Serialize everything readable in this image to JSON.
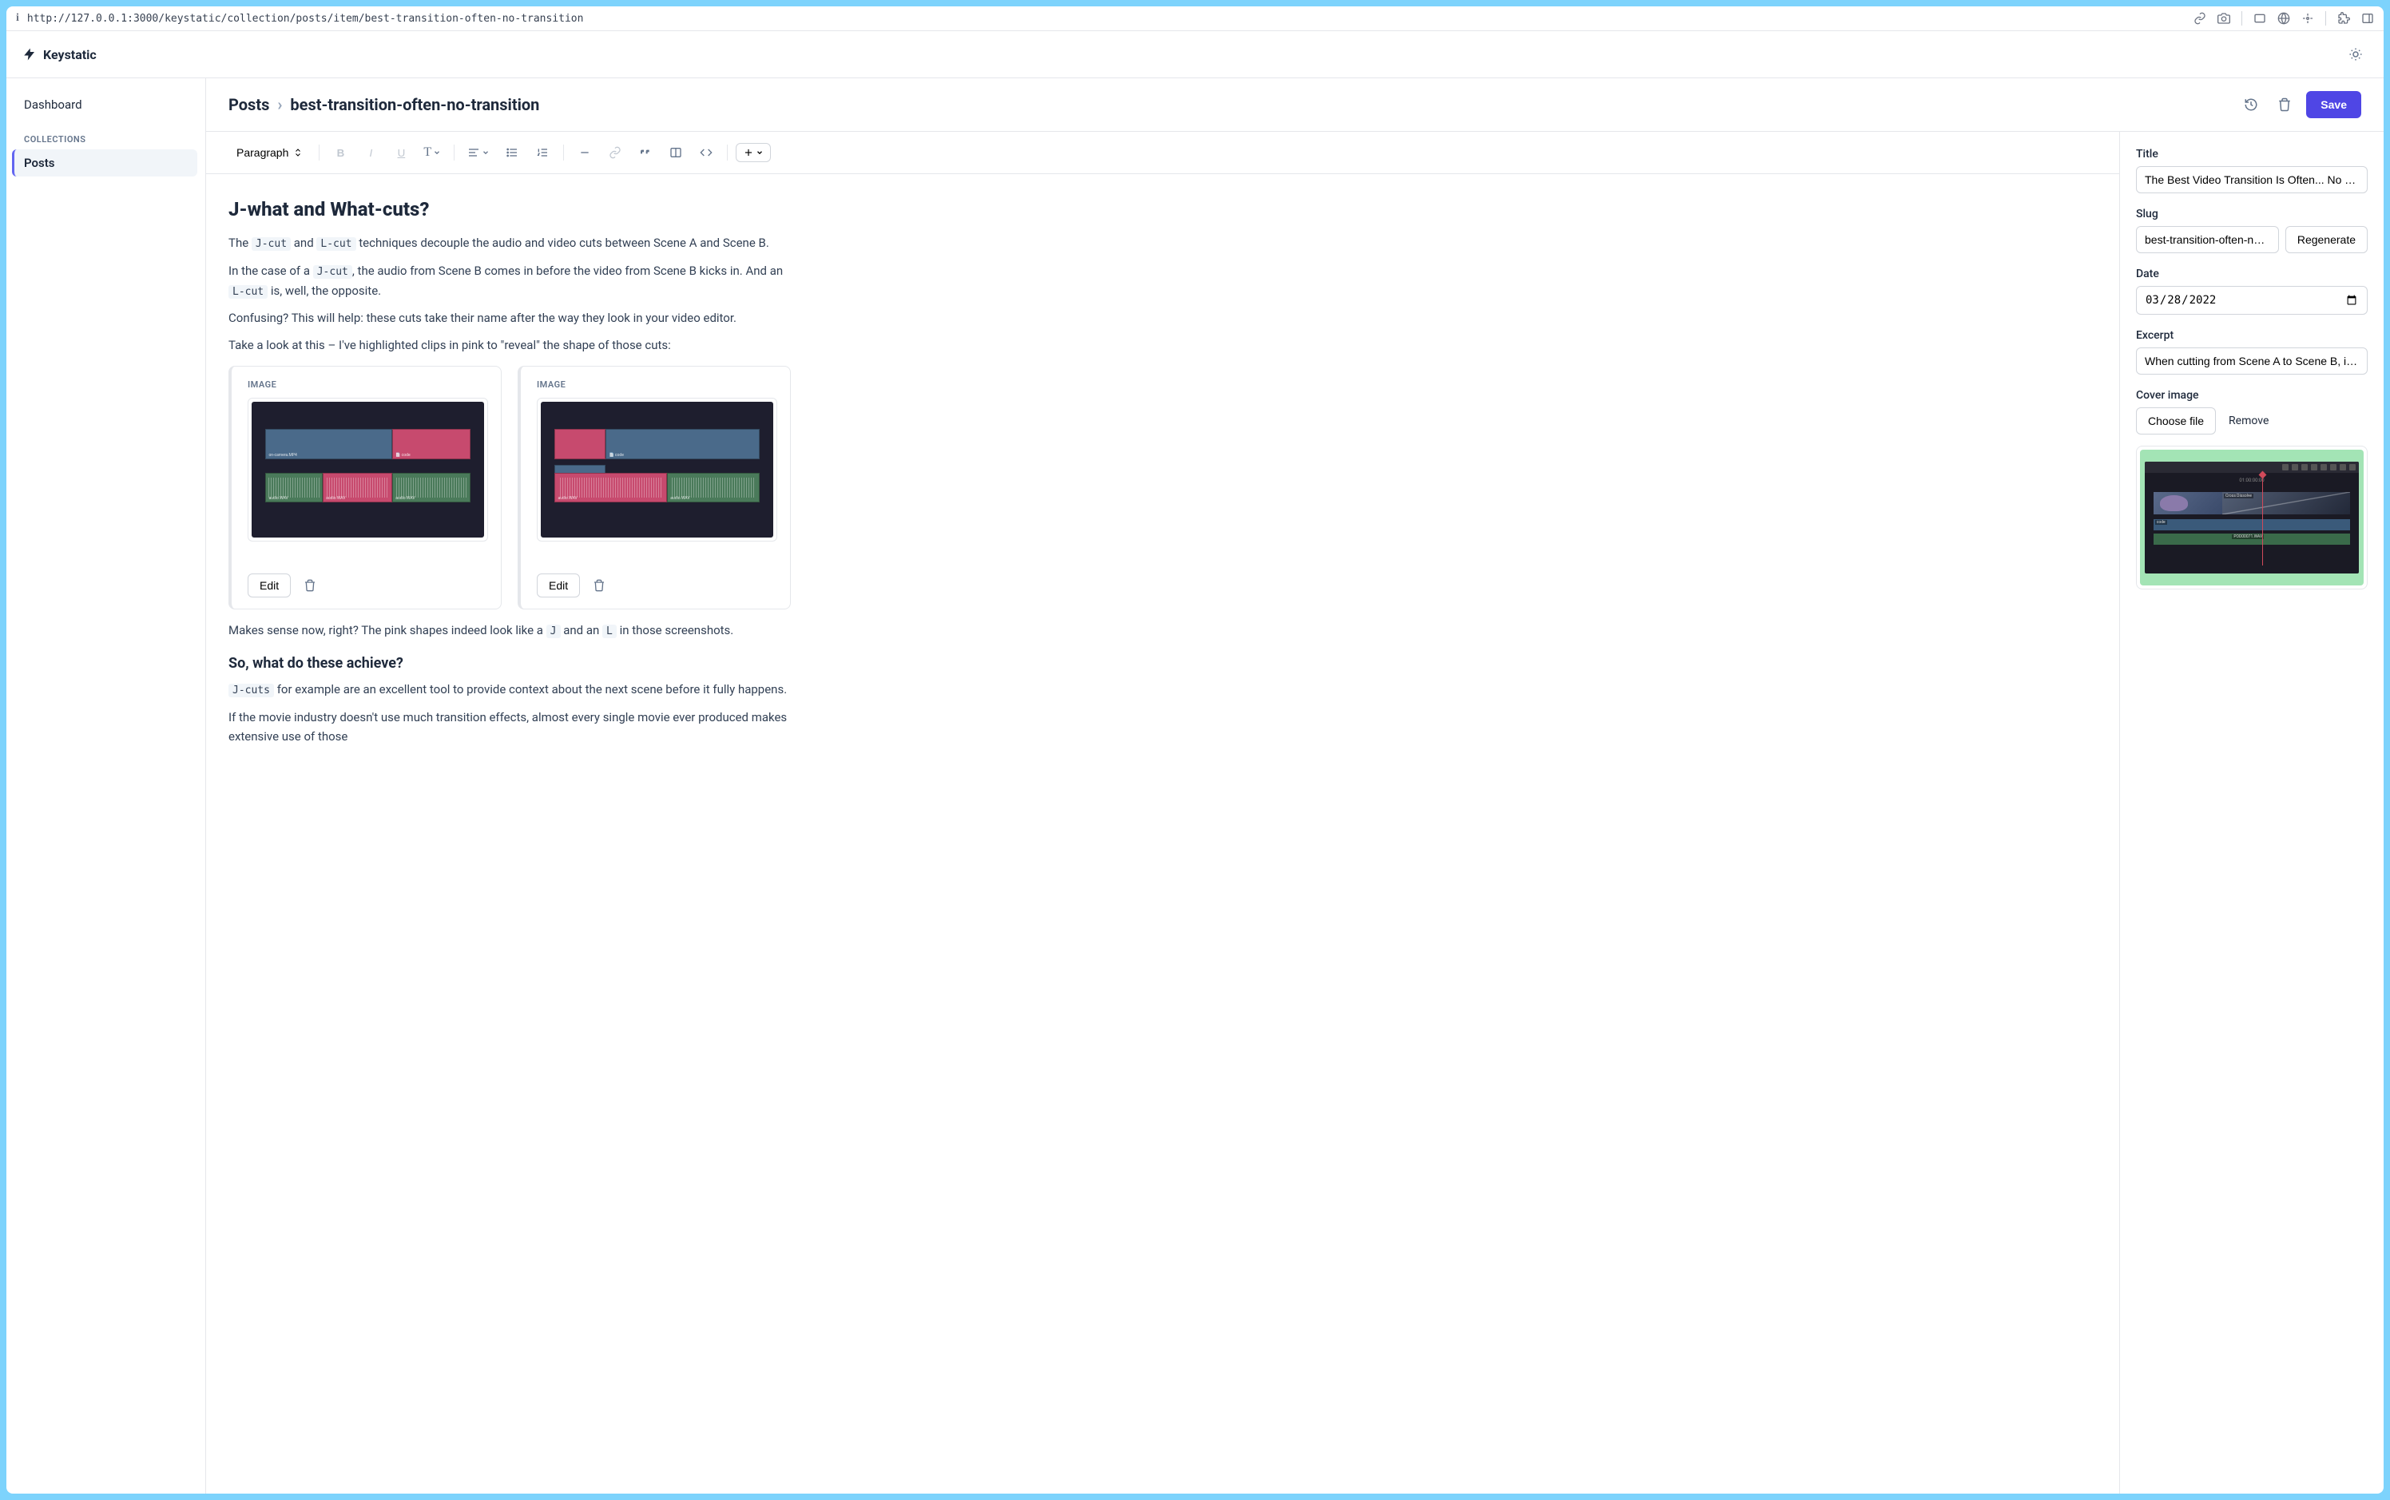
{
  "browser": {
    "url": "http://127.0.0.1:3000/keystatic/collection/posts/item/best-transition-often-no-transition"
  },
  "app": {
    "brand": "Keystatic"
  },
  "sidebar": {
    "dashboard": "Dashboard",
    "section": "COLLECTIONS",
    "items": [
      {
        "label": "Posts"
      }
    ]
  },
  "breadcrumb": {
    "collection": "Posts",
    "item": "best-transition-often-no-transition"
  },
  "actions": {
    "save": "Save"
  },
  "toolbar": {
    "paragraph": "Paragraph"
  },
  "document": {
    "heading1": "J-what and What-cuts?",
    "p1_a": "The ",
    "p1_code1": "J-cut",
    "p1_b": " and ",
    "p1_code2": "L-cut",
    "p1_c": " techniques decouple the audio and video cuts between Scene A and Scene B.",
    "p2_a": "In the case of a ",
    "p2_code1": "J-cut",
    "p2_b": ", the audio from Scene B comes in before the video from Scene B kicks in. And an ",
    "p2_code2": "L-cut",
    "p2_c": " is, well, the opposite.",
    "p3": "Confusing? This will help: these cuts take their name after the way they look in your video editor.",
    "p4": "Take a look at this – I've highlighted clips in pink to \"reveal\" the shape of those cuts:",
    "image_label": "IMAGE",
    "edit": "Edit",
    "p5_a": "Makes sense now, right? The pink shapes indeed look like a ",
    "p5_code1": "J",
    "p5_b": " and an ",
    "p5_code2": "L",
    "p5_c": " in those screenshots.",
    "heading2": "So, what do these achieve?",
    "p6_code": "J-cuts",
    "p6_a": " for example are an excellent tool to provide context about the next scene before it fully happens.",
    "p7": "If the movie industry doesn't use much transition effects, almost every single movie ever produced makes extensive use of those"
  },
  "fields": {
    "title_label": "Title",
    "title_value": "The Best Video Transition Is Often... No Transition",
    "slug_label": "Slug",
    "slug_value": "best-transition-often-no-transition",
    "regenerate": "Regenerate",
    "date_label": "Date",
    "date_value": "2022-03-28",
    "excerpt_label": "Excerpt",
    "excerpt_value": "When cutting from Scene A to Scene B, it's tempting to reach for a fancy transition effect...",
    "cover_label": "Cover image",
    "choose_file": "Choose file",
    "remove": "Remove",
    "cross_dissolve": "Cross Dissolve",
    "timecode": "01:00:00:00",
    "aud_code": "code",
    "aud_pod": "POD00071.WAV"
  }
}
